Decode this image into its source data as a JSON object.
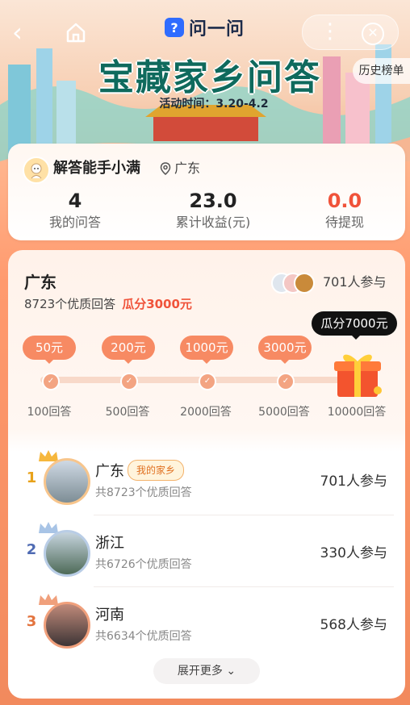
{
  "app": {
    "name": "问一问",
    "logo_mark": "?"
  },
  "header": {
    "title": "宝藏家乡问答",
    "activity_time": "活动时间：3.20-4.2",
    "history_button": "历史榜单"
  },
  "user": {
    "name": "解答能手小满",
    "location": "广东",
    "stats": [
      {
        "value": "4",
        "label": "我的问答"
      },
      {
        "value": "23.0",
        "label": "累计收益(元)"
      },
      {
        "value": "0.0",
        "label": "待提现"
      }
    ]
  },
  "region_card": {
    "name": "广东",
    "quality_text": "8723个优质回答",
    "prize_text": "瓜分3000元",
    "participants": "701人参与",
    "top_prize_tooltip": "瓜分7000元",
    "milestones": [
      {
        "reward": "50元",
        "target": "100回答"
      },
      {
        "reward": "200元",
        "target": "500回答"
      },
      {
        "reward": "1000元",
        "target": "2000回答"
      },
      {
        "reward": "3000元",
        "target": "5000回答"
      },
      {
        "reward": "",
        "target": "10000回答"
      }
    ],
    "check_mark": "✓"
  },
  "ranking": [
    {
      "rank": "1",
      "name": "广东",
      "tag": "我的家乡",
      "sub": "共8723个优质回答",
      "participants": "701人参与",
      "rank_color": "#e8a21a"
    },
    {
      "rank": "2",
      "name": "浙江",
      "tag": "",
      "sub": "共6726个优质回答",
      "participants": "330人参与",
      "rank_color": "#4f6bb3"
    },
    {
      "rank": "3",
      "name": "河南",
      "tag": "",
      "sub": "共6634个优质回答",
      "participants": "568人参与",
      "rank_color": "#e3743f"
    }
  ],
  "expand_button": "展开更多 ⌄",
  "icons": {
    "back": "back-icon",
    "home": "home-icon",
    "more": "more-icon",
    "close": "close-icon",
    "location": "location-pin-icon",
    "gift": "gift-box-icon"
  }
}
